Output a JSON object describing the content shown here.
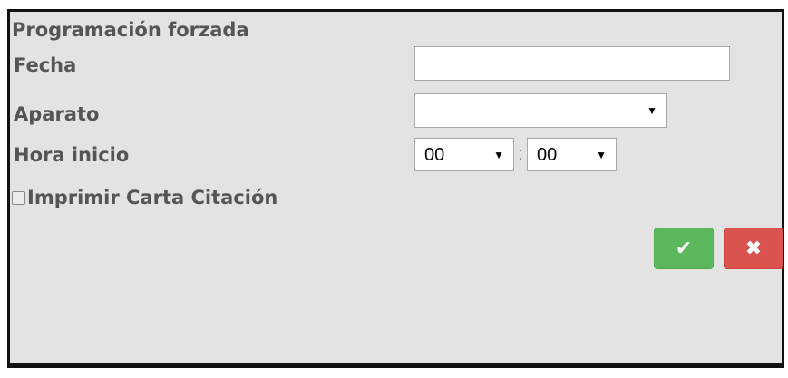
{
  "dialog": {
    "title": "Programación forzada",
    "fields": {
      "fecha_label": "Fecha",
      "fecha_value": "",
      "aparato_label": "Aparato",
      "aparato_value": "",
      "hora_label": "Hora inicio",
      "hora_hours": "00",
      "hora_separator": ":",
      "hora_minutes": "00"
    },
    "checkbox": {
      "label": "Imprimir Carta Citación",
      "checked": false
    },
    "buttons": {
      "confirm_icon": "check-icon",
      "confirm_glyph": "✔",
      "cancel_icon": "close-icon",
      "cancel_glyph": "✖"
    },
    "colors": {
      "background": "#e3e3e3",
      "label_text": "#555555",
      "confirm": "#5cb85c",
      "cancel": "#d9534f"
    }
  }
}
